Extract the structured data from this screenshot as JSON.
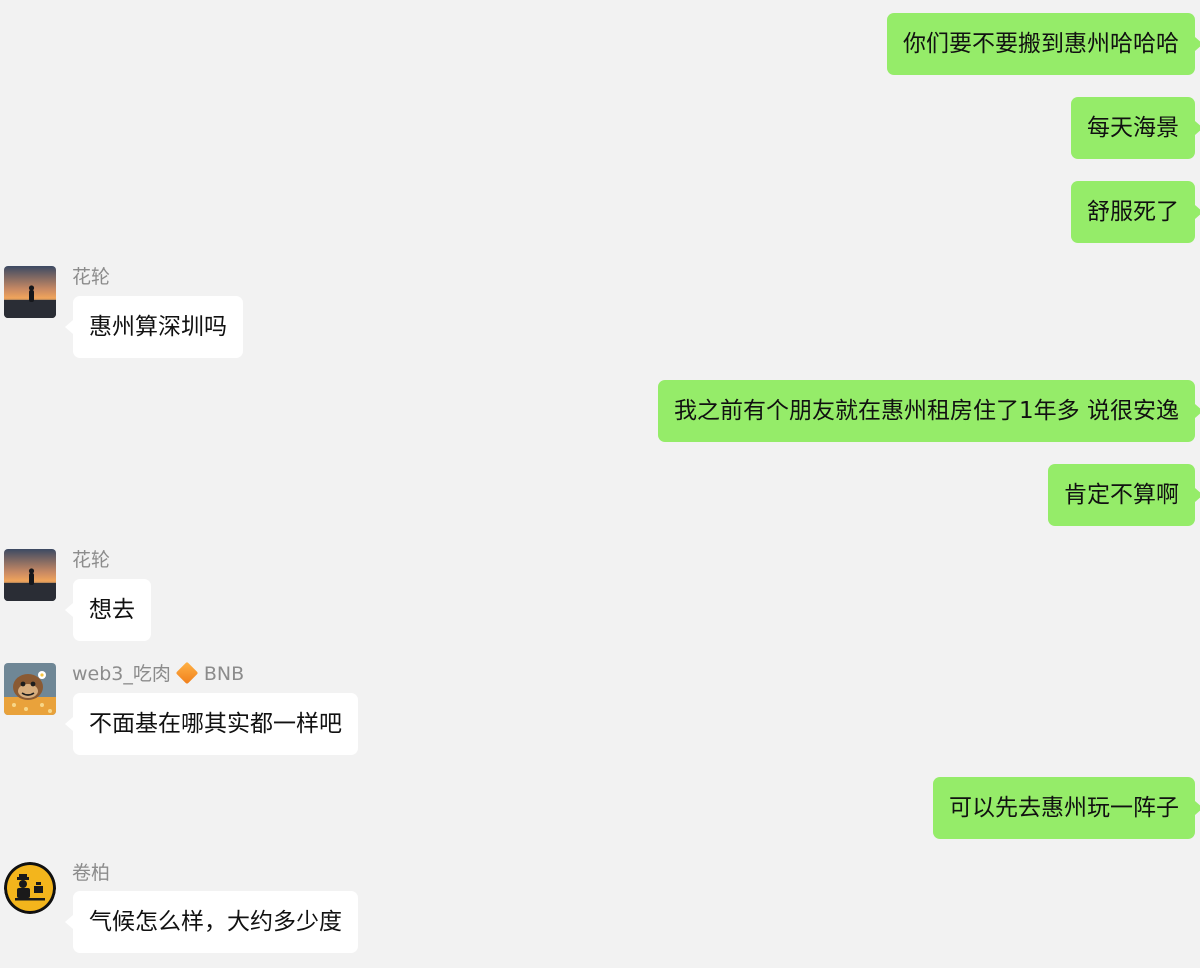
{
  "messages": [
    {
      "direction": "out",
      "text": "你们要不要搬到惠州哈哈哈"
    },
    {
      "direction": "out",
      "text": "每天海景"
    },
    {
      "direction": "out",
      "text": "舒服死了"
    },
    {
      "direction": "in",
      "sender": "花轮",
      "avatar": "sunset-avatar",
      "text": "惠州算深圳吗"
    },
    {
      "direction": "out",
      "text": "我之前有个朋友就在惠州租房住了1年多 说很安逸"
    },
    {
      "direction": "out",
      "text": "肯定不算啊"
    },
    {
      "direction": "in",
      "sender": "花轮",
      "avatar": "sunset-avatar",
      "text": "想去"
    },
    {
      "direction": "in",
      "sender": "web3_吃肉",
      "sender_badge_icon": "orange-diamond-icon",
      "sender_suffix": "BNB",
      "avatar": "cartoon-monkey-avatar",
      "text": "不面基在哪其实都一样吧"
    },
    {
      "direction": "out",
      "text": "可以先去惠州玩一阵子"
    },
    {
      "direction": "in",
      "sender": "卷柏",
      "avatar": "yellow-circle-avatar",
      "text": "气候怎么样，大约多少度"
    }
  ],
  "colors": {
    "background": "#f2f2f2",
    "outgoing_bubble": "#95ec69",
    "incoming_bubble": "#ffffff",
    "sender_name": "#8c8c8c",
    "badge": "#f39a2e"
  }
}
